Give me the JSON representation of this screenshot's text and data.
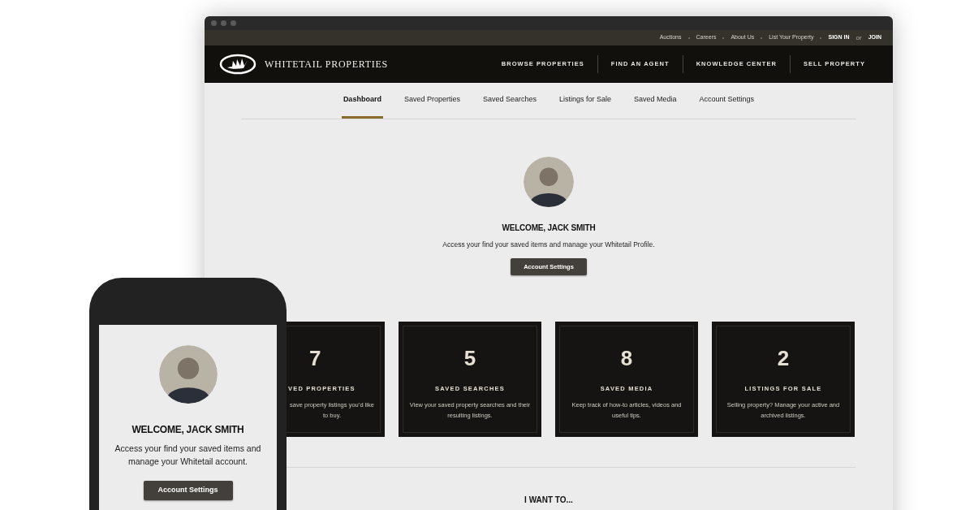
{
  "browser": {
    "top_links": [
      "Auctions",
      "Careers",
      "About Us",
      "List Your Property"
    ],
    "account": {
      "sign_in": "SIGN IN",
      "or": "or",
      "join": "JOIN"
    },
    "brand": "WHITETAIL PROPERTIES",
    "nav": [
      "BROWSE PROPERTIES",
      "FIND AN AGENT",
      "KNOWLEDGE CENTER",
      "SELL PROPERTY"
    ],
    "tabs": [
      {
        "label": "Dashboard",
        "selected": true
      },
      {
        "label": "Saved Properties",
        "selected": false
      },
      {
        "label": "Saved Searches",
        "selected": false
      },
      {
        "label": "Listings for Sale",
        "selected": false
      },
      {
        "label": "Saved Media",
        "selected": false
      },
      {
        "label": "Account Settings",
        "selected": false
      }
    ],
    "profile": {
      "heading": "WELCOME, JACK SMITH",
      "text": "Access your find your saved items and manage your Whitetail Profile.",
      "button": "Account Settings"
    },
    "stats": [
      {
        "number": "7",
        "title": "VED PROPERTIES",
        "description": "save property listings you’d like to buy.",
        "clipped": true
      },
      {
        "number": "5",
        "title": "SAVED SEARCHES",
        "description": "View your saved property searches and their resulting listings.",
        "clipped": false
      },
      {
        "number": "8",
        "title": "SAVED MEDIA",
        "description": "Keep track of how-to articles, videos and useful tips.",
        "clipped": false
      },
      {
        "number": "2",
        "title": "LISTINGS FOR SALE",
        "description": "Selling property? Manage your active and archived listings.",
        "clipped": false
      }
    ],
    "section_heading": "I WANT TO..."
  },
  "phone": {
    "heading": "WELCOME, JACK SMITH",
    "text": "Access your find your saved items and manage your Whitetail account.",
    "button": "Account Settings"
  }
}
